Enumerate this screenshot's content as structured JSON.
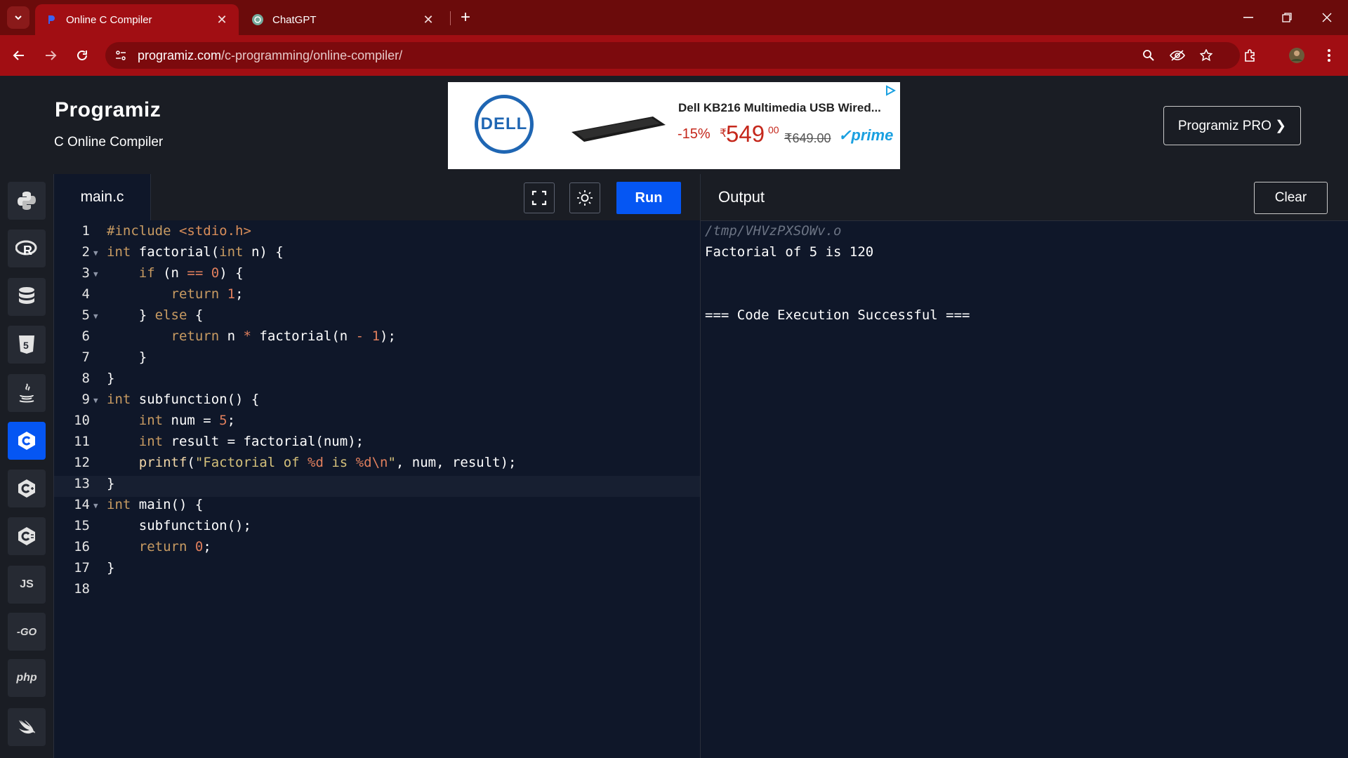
{
  "browser": {
    "tabs": [
      {
        "title": "Online C Compiler",
        "active": true,
        "icon": "programiz-favicon"
      },
      {
        "title": "ChatGPT",
        "active": false,
        "icon": "chatgpt-favicon"
      }
    ],
    "url_host": "programiz.com",
    "url_path": "/c-programming/online-compiler/",
    "colors": {
      "tabbar": "#6b0b0b",
      "toolbar": "#a10e13"
    }
  },
  "header": {
    "logo": "Programiz",
    "subtitle": "C Online Compiler",
    "pro_button": "Programiz PRO ❯"
  },
  "ad": {
    "brand": "DELL",
    "title": "Dell KB216 Multimedia USB Wired...",
    "discount": "-15%",
    "currency": "₹",
    "price": "549",
    "price_cents": "00",
    "old_price": "₹649.00",
    "badge": "✓prime"
  },
  "languages": [
    {
      "name": "python",
      "label": "",
      "active": false
    },
    {
      "name": "r",
      "label": "R",
      "active": false
    },
    {
      "name": "sql",
      "label": "",
      "active": false
    },
    {
      "name": "html",
      "label": "5",
      "active": false
    },
    {
      "name": "java",
      "label": "",
      "active": false
    },
    {
      "name": "c",
      "label": "C",
      "active": true
    },
    {
      "name": "cpp",
      "label": "C",
      "active": false
    },
    {
      "name": "csharp",
      "label": "C",
      "active": false
    },
    {
      "name": "js",
      "label": "JS",
      "active": false
    },
    {
      "name": "go",
      "label": "-GO",
      "active": false
    },
    {
      "name": "php",
      "label": "php",
      "active": false
    },
    {
      "name": "swift",
      "label": "",
      "active": false
    }
  ],
  "editor": {
    "filename": "main.c",
    "run_label": "Run",
    "current_line": 13,
    "lines": [
      "#include <stdio.h>",
      "int factorial(int n) {",
      "    if (n == 0) {",
      "        return 1;",
      "    } else {",
      "        return n * factorial(n - 1);",
      "    }",
      "}",
      "int subfunction() {",
      "    int num = 5;",
      "    int result = factorial(num);",
      "    printf(\"Factorial of %d is %d\\n\", num, result);",
      "}",
      "int main() {",
      "    subfunction();",
      "    return 0;",
      "}",
      ""
    ],
    "fold_lines": [
      2,
      3,
      5,
      9,
      14
    ]
  },
  "output": {
    "title": "Output",
    "clear_label": "Clear",
    "lines": [
      "/tmp/VHVzPXSOWv.o",
      "Factorial of 5 is 120",
      "",
      "",
      "=== Code Execution Successful ==="
    ]
  }
}
